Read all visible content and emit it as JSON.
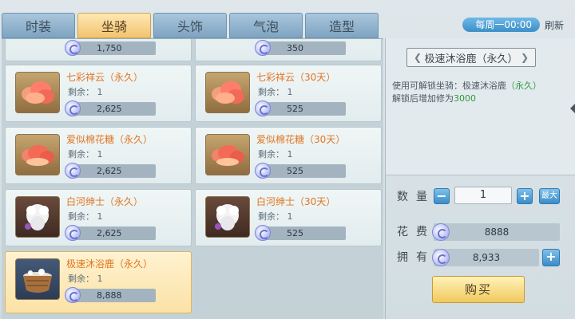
{
  "tabs": [
    {
      "label": "时装",
      "active": false
    },
    {
      "label": "坐骑",
      "active": true
    },
    {
      "label": "头饰",
      "active": false
    },
    {
      "label": "气泡",
      "active": false
    },
    {
      "label": "造型",
      "active": false
    }
  ],
  "refresh": {
    "timer": "每周一00:00",
    "label": "刷新"
  },
  "partial_row": [
    {
      "price": "1,750"
    },
    {
      "price": "350"
    }
  ],
  "items": [
    {
      "name": "七彩祥云（永久）",
      "remain": "剩余：  1",
      "price": "2,625",
      "icon": "rainbow-cloud-icon",
      "selected": false
    },
    {
      "name": "七彩祥云（30天）",
      "remain": "剩余：  1",
      "price": "525",
      "icon": "rainbow-cloud-icon",
      "selected": false
    },
    {
      "name": "爱似棉花糖（永久）",
      "remain": "剩余：  1",
      "price": "2,625",
      "icon": "cotton-candy-icon",
      "selected": false
    },
    {
      "name": "爱似棉花糖（30天）",
      "remain": "剩余：  1",
      "price": "525",
      "icon": "cotton-candy-icon",
      "selected": false
    },
    {
      "name": "白河绅士（永久）",
      "remain": "剩余：  1",
      "price": "2,625",
      "icon": "white-gentleman-icon",
      "selected": false
    },
    {
      "name": "白河绅士（30天）",
      "remain": "剩余：  1",
      "price": "525",
      "icon": "white-gentleman-icon",
      "selected": false
    },
    {
      "name": "极速沐浴鹿（永久）",
      "remain": "剩余：  1",
      "price": "8,888",
      "icon": "bath-tub-icon",
      "selected": true
    }
  ],
  "detail": {
    "title": "极速沐浴鹿（永久）",
    "desc_prefix": "使用可解锁坐骑：极速沐浴鹿",
    "desc_green": "（永久）",
    "desc_line2": "解锁后增加修为",
    "desc_value": "3000",
    "qty_label": "数量",
    "qty_value": "1",
    "minus": "−",
    "plus": "+",
    "max_label": "最大",
    "cost_label": "花费",
    "cost_value": "8888",
    "own_label": "拥有",
    "own_value": "8,933",
    "add": "+",
    "buy_label": "购买"
  },
  "colors": {
    "accent": "#e07622",
    "tab_active": "#f1c470",
    "tab_inactive": "#7ea3c1",
    "green_text": "#2e9a3e"
  }
}
